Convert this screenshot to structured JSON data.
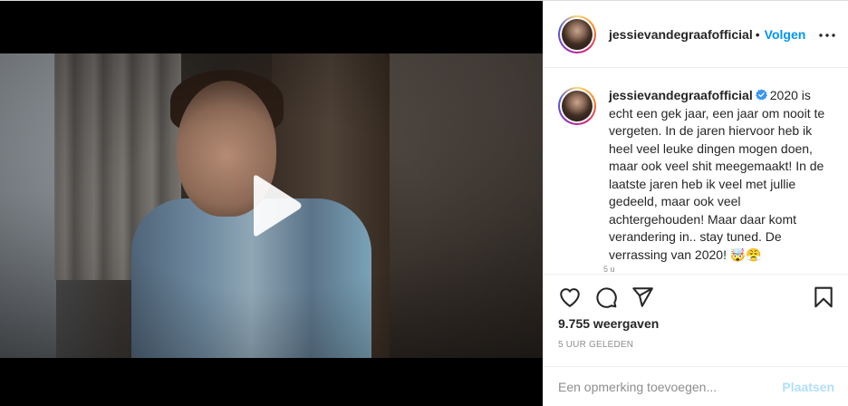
{
  "header": {
    "username": "jessievandegraafofficial",
    "separator": "•",
    "follow_label": "Volgen",
    "more_icon": "more-horizontal-icon"
  },
  "media": {
    "play_icon": "play-icon"
  },
  "caption": {
    "username": "jessievandegraafofficial",
    "verified_icon": "verified-badge-icon",
    "text": "2020 is echt een gek jaar, een jaar om nooit te vergeten. In de jaren hiervoor heb ik heel veel leuke dingen mogen doen, maar ook veel shit meegemaakt! In de laatste jaren heb ik veel met jullie gedeeld, maar ook veel achtergehouden! Maar daar komt verandering in.. stay tuned. De verrassing van 2020! 🤯😤",
    "time_peek": "5 u"
  },
  "actions": {
    "like_icon": "heart-icon",
    "comment_icon": "comment-icon",
    "share_icon": "send-icon",
    "save_icon": "bookmark-icon",
    "views": "9.755 weergaven",
    "posted": "5 UUR GELEDEN"
  },
  "comment": {
    "placeholder": "Een opmerking toevoegen...",
    "post_label": "Plaatsen"
  },
  "colors": {
    "accent": "#0095f6",
    "post_disabled": "#b2dffc",
    "muted": "#8e8e8e",
    "text": "#262626"
  }
}
